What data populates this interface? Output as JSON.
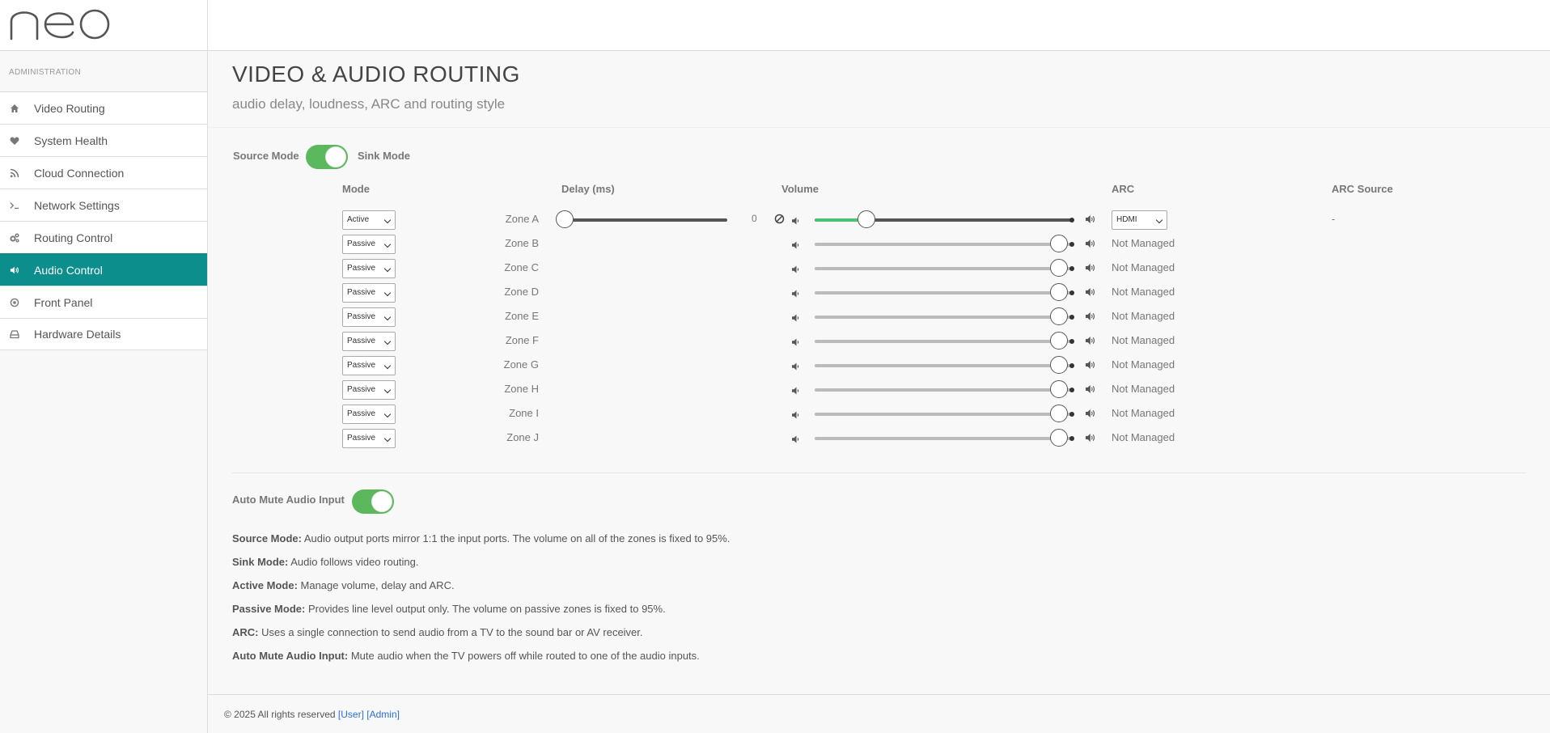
{
  "brand": {
    "logo_text": "neo"
  },
  "sidebar": {
    "heading": "ADMINISTRATION",
    "items": [
      {
        "label": "Video Routing",
        "icon": "home-icon",
        "active": false
      },
      {
        "label": "System Health",
        "icon": "heart-icon",
        "active": false
      },
      {
        "label": "Cloud Connection",
        "icon": "rss-icon",
        "active": false
      },
      {
        "label": "Network Settings",
        "icon": "terminal-icon",
        "active": false
      },
      {
        "label": "Routing Control",
        "icon": "cogs-icon",
        "active": false
      },
      {
        "label": "Audio Control",
        "icon": "volume-icon",
        "active": true
      },
      {
        "label": "Front Panel",
        "icon": "target-icon",
        "active": false
      },
      {
        "label": "Hardware Details",
        "icon": "hdd-icon",
        "active": false
      }
    ]
  },
  "page": {
    "title": "VIDEO & AUDIO ROUTING",
    "subtitle": "audio delay, loudness, ARC and routing style"
  },
  "mode_toggle": {
    "left_label": "Source Mode",
    "right_label": "Sink Mode",
    "state": "on"
  },
  "columns": {
    "mode": "Mode",
    "delay": "Delay (ms)",
    "volume": "Volume",
    "arc": "ARC",
    "arc_source": "ARC Source"
  },
  "zones": [
    {
      "name": "Zone A",
      "mode": "Active",
      "delay": "0",
      "delay_fraction": 0.0,
      "volume_fraction": 0.2,
      "arc": "HDMI",
      "arc_source": "-"
    },
    {
      "name": "Zone B",
      "mode": "Passive",
      "volume_fraction": 0.95,
      "arc": "Not Managed"
    },
    {
      "name": "Zone C",
      "mode": "Passive",
      "volume_fraction": 0.95,
      "arc": "Not Managed"
    },
    {
      "name": "Zone D",
      "mode": "Passive",
      "volume_fraction": 0.95,
      "arc": "Not Managed"
    },
    {
      "name": "Zone E",
      "mode": "Passive",
      "volume_fraction": 0.95,
      "arc": "Not Managed"
    },
    {
      "name": "Zone F",
      "mode": "Passive",
      "volume_fraction": 0.95,
      "arc": "Not Managed"
    },
    {
      "name": "Zone G",
      "mode": "Passive",
      "volume_fraction": 0.95,
      "arc": "Not Managed"
    },
    {
      "name": "Zone H",
      "mode": "Passive",
      "volume_fraction": 0.95,
      "arc": "Not Managed"
    },
    {
      "name": "Zone I",
      "mode": "Passive",
      "volume_fraction": 0.95,
      "arc": "Not Managed"
    },
    {
      "name": "Zone J",
      "mode": "Passive",
      "volume_fraction": 0.95,
      "arc": "Not Managed"
    }
  ],
  "auto_mute": {
    "label": "Auto Mute Audio Input",
    "state": "on"
  },
  "legend": [
    {
      "term": "Source Mode:",
      "text": " Audio output ports mirror 1:1 the input ports. The volume on all of the zones is fixed to 95%."
    },
    {
      "term": "Sink Mode:",
      "text": " Audio follows video routing."
    },
    {
      "term": "Active Mode:",
      "text": " Manage volume, delay and ARC."
    },
    {
      "term": "Passive Mode:",
      "text": " Provides line level output only. The volume on passive zones is fixed to 95%."
    },
    {
      "term": "ARC:",
      "text": " Uses a single connection to send audio from a TV to the sound bar or AV receiver."
    },
    {
      "term": "Auto Mute Audio Input:",
      "text": " Mute audio when the TV powers off while routed to one of the audio inputs."
    }
  ],
  "footer": {
    "copyright": "© 2025 All rights reserved ",
    "user_link": "[User]",
    "admin_link": "[Admin]"
  },
  "colors": {
    "accent": "#0b8e8c",
    "toggle_on": "#5cb85c",
    "volume_fill": "#4cc475"
  }
}
